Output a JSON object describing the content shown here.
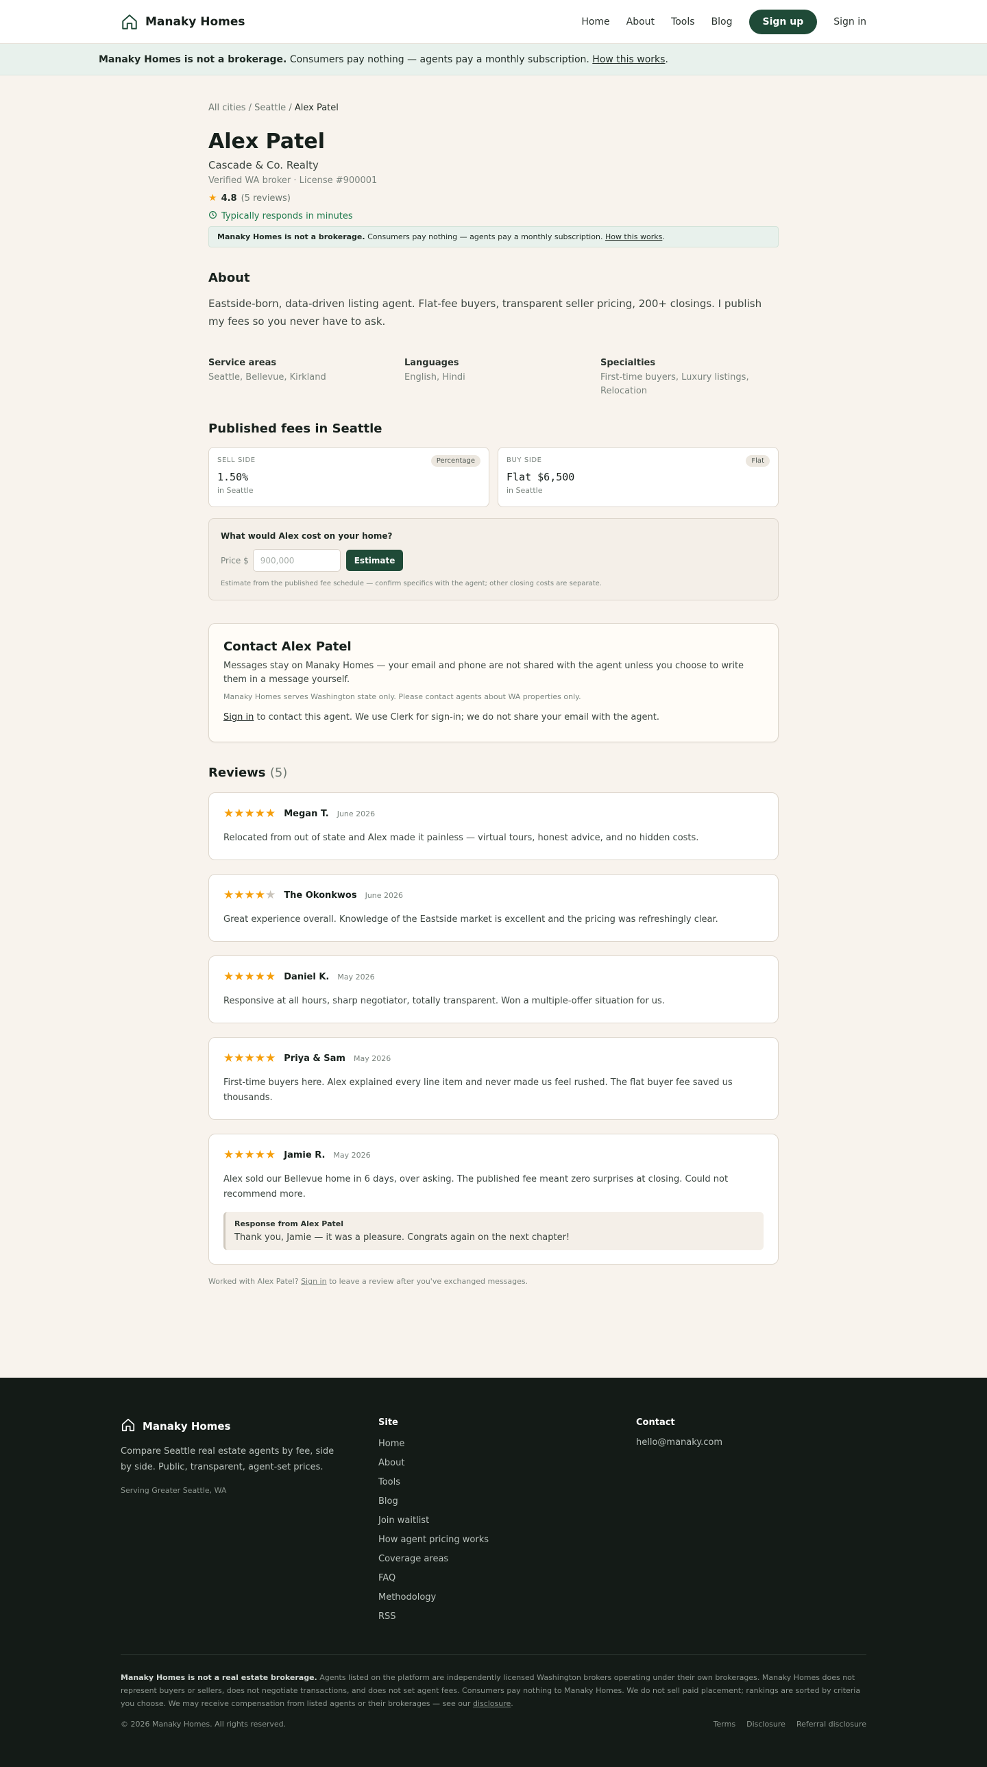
{
  "header": {
    "brand": "Manaky Homes",
    "nav": [
      "Home",
      "About",
      "Tools",
      "Blog"
    ],
    "signup": "Sign up",
    "signin": "Sign in"
  },
  "banner": {
    "bold": "Manaky Homes is not a brokerage.",
    "text": " Consumers pay nothing — agents pay a monthly subscription. ",
    "link": "How this works",
    "end": "."
  },
  "breadcrumb": {
    "all": "All cities",
    "sep": " / ",
    "city": "Seattle",
    "current": "Alex Patel"
  },
  "agent": {
    "name": "Alex Patel",
    "brokerage": "Cascade & Co. Realty",
    "license": "Verified WA broker · License #900001",
    "rating": "4.8",
    "review_count": "(5 reviews)",
    "responds": "Typically responds in minutes"
  },
  "about": {
    "title": "About",
    "text": "Eastside-born, data-driven listing agent. Flat-fee buyers, transparent seller pricing, 200+ closings. I publish my fees so you never have to ask."
  },
  "facts": [
    {
      "label": "Service areas",
      "value": "Seattle, Bellevue, Kirkland"
    },
    {
      "label": "Languages",
      "value": "English, Hindi"
    },
    {
      "label": "Specialties",
      "value": "First-time buyers, Luxury listings, Relocation"
    }
  ],
  "fees": {
    "title": "Published fees in Seattle",
    "cards": [
      {
        "side": "SELL SIDE",
        "tag": "Percentage",
        "amount": "1.50%",
        "city": "in Seattle"
      },
      {
        "side": "BUY SIDE",
        "tag": "Flat",
        "amount": "Flat $6,500",
        "city": "in Seattle"
      }
    ]
  },
  "estimator": {
    "title": "What would Alex cost on your home?",
    "label": "Price $",
    "placeholder": "900,000",
    "button": "Estimate",
    "note": "Estimate from the published fee schedule — confirm specifics with the agent; other closing costs are separate."
  },
  "contact": {
    "title": "Contact Alex Patel",
    "desc": "Messages stay on Manaky Homes — your email and phone are not shared with the agent unless you choose to write them in a message yourself.",
    "scope": "Manaky Homes serves Washington state only. Please contact agents about WA properties only.",
    "signin_link": "Sign in",
    "signin_text": " to contact this agent. We use Clerk for sign-in; we do not share your email with the agent."
  },
  "reviews": {
    "title": "Reviews",
    "count": "(5)",
    "items": [
      {
        "stars": 5,
        "name": "Megan T.",
        "date": "June 2026",
        "text": "Relocated from out of state and Alex made it painless — virtual tours, honest advice, and no hidden costs."
      },
      {
        "stars": 4,
        "name": "The Okonkwos",
        "date": "June 2026",
        "text": "Great experience overall. Knowledge of the Eastside market is excellent and the pricing was refreshingly clear."
      },
      {
        "stars": 5,
        "name": "Daniel K.",
        "date": "May 2026",
        "text": "Responsive at all hours, sharp negotiator, totally transparent. Won a multiple-offer situation for us."
      },
      {
        "stars": 5,
        "name": "Priya & Sam",
        "date": "May 2026",
        "text": "First-time buyers here. Alex explained every line item and never made us feel rushed. The flat buyer fee saved us thousands."
      },
      {
        "stars": 5,
        "name": "Jamie R.",
        "date": "May 2026",
        "text": "Alex sold our Bellevue home in 6 days, over asking. The published fee meant zero surprises at closing. Could not recommend more.",
        "response_title": "Response from Alex Patel",
        "response_text": "Thank you, Jamie — it was a pleasure. Congrats again on the next chapter!"
      }
    ],
    "worked_pre": "Worked with Alex Patel? ",
    "worked_link": "Sign in",
    "worked_post": " to leave a review after you've exchanged messages."
  },
  "footer": {
    "brand": "Manaky Homes",
    "tagline": "Compare Seattle real estate agents by fee, side by side. Public, transparent, agent-set prices.",
    "serving": "Serving Greater Seattle, WA",
    "site_title": "Site",
    "site_links": [
      "Home",
      "About",
      "Tools",
      "Blog",
      "Join waitlist",
      "How agent pricing works",
      "Coverage areas",
      "FAQ",
      "Methodology",
      "RSS"
    ],
    "contact_title": "Contact",
    "email": "hello@manaky.com",
    "disclaimer_bold": "Manaky Homes is not a real estate brokerage.",
    "disclaimer_text": " Agents listed on the platform are independently licensed Washington brokers operating under their own brokerages. Manaky Homes does not represent buyers or sellers, does not negotiate transactions, and does not set agent fees. Consumers pay nothing to Manaky Homes. We do not sell paid placement; rankings are sorted by criteria you choose. We may receive compensation from listed agents or their brokerages — see our ",
    "disclaimer_link": "disclosure",
    "disclaimer_end": ".",
    "copyright": "© 2026 Manaky Homes. All rights reserved.",
    "legal": [
      "Terms",
      "Disclosure",
      "Referral disclosure"
    ]
  },
  "colors": {
    "accent": "#1f4a37",
    "star": "#f59e0b",
    "responds": "#1e7a4c",
    "footer_bg": "#141b17",
    "page_bg": "#f8f3ed"
  }
}
